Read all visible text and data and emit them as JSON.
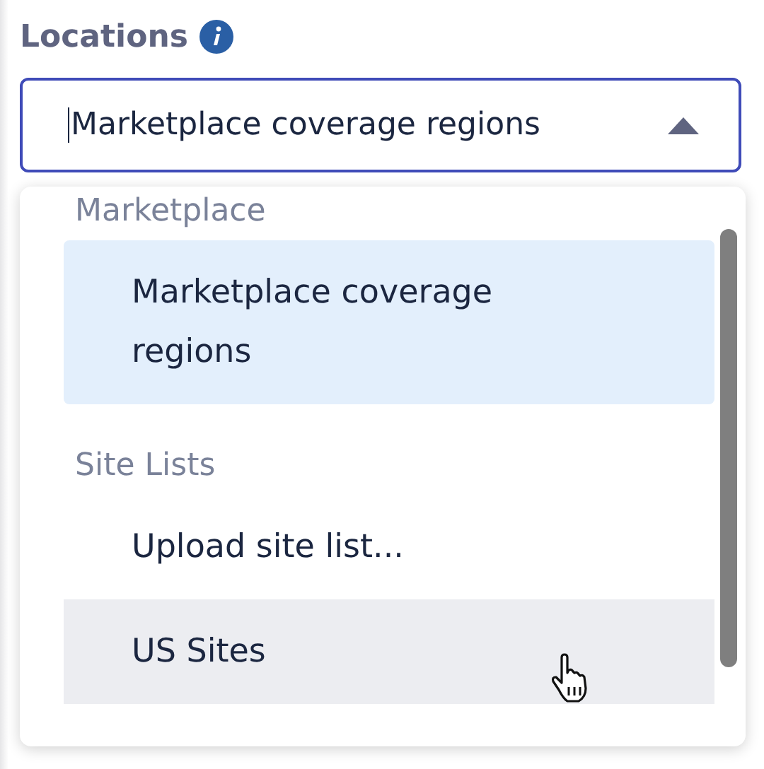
{
  "label": "Locations",
  "field": {
    "value": "Marketplace coverage regions",
    "expanded": true
  },
  "dropdown": {
    "groups": [
      {
        "heading": "Marketplace",
        "options": [
          {
            "label": "Marketplace coverage regions",
            "selected": true,
            "hovered": false
          }
        ]
      },
      {
        "heading": "Site Lists",
        "options": [
          {
            "label": "Upload site list...",
            "selected": false,
            "hovered": false
          },
          {
            "label": "US Sites",
            "selected": false,
            "hovered": true
          }
        ]
      }
    ]
  }
}
